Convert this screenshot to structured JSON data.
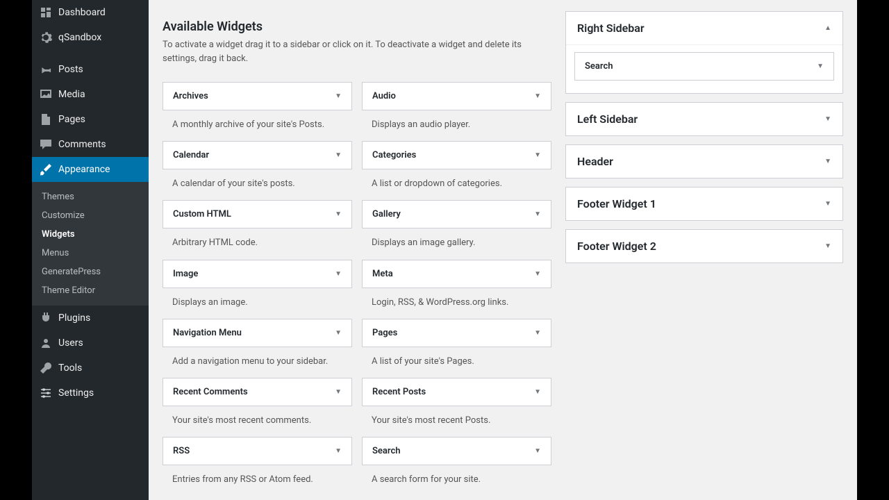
{
  "sidebar": {
    "items": [
      {
        "label": "Dashboard"
      },
      {
        "label": "qSandbox"
      },
      {
        "label": "Posts"
      },
      {
        "label": "Media"
      },
      {
        "label": "Pages"
      },
      {
        "label": "Comments"
      },
      {
        "label": "Appearance"
      },
      {
        "label": "Plugins"
      },
      {
        "label": "Users"
      },
      {
        "label": "Tools"
      },
      {
        "label": "Settings"
      }
    ],
    "submenu": [
      {
        "label": "Themes"
      },
      {
        "label": "Customize"
      },
      {
        "label": "Widgets"
      },
      {
        "label": "Menus"
      },
      {
        "label": "GeneratePress"
      },
      {
        "label": "Theme Editor"
      }
    ]
  },
  "main": {
    "heading": "Available Widgets",
    "description": "To activate a widget drag it to a sidebar or click on it. To deactivate a widget and delete its settings, drag it back.",
    "widgets": [
      {
        "title": "Archives",
        "desc": "A monthly archive of your site's Posts."
      },
      {
        "title": "Audio",
        "desc": "Displays an audio player."
      },
      {
        "title": "Calendar",
        "desc": "A calendar of your site's posts."
      },
      {
        "title": "Categories",
        "desc": "A list or dropdown of categories."
      },
      {
        "title": "Custom HTML",
        "desc": "Arbitrary HTML code."
      },
      {
        "title": "Gallery",
        "desc": "Displays an image gallery."
      },
      {
        "title": "Image",
        "desc": "Displays an image."
      },
      {
        "title": "Meta",
        "desc": "Login, RSS, & WordPress.org links."
      },
      {
        "title": "Navigation Menu",
        "desc": "Add a navigation menu to your sidebar."
      },
      {
        "title": "Pages",
        "desc": "A list of your site's Pages."
      },
      {
        "title": "Recent Comments",
        "desc": "Your site's most recent comments."
      },
      {
        "title": "Recent Posts",
        "desc": "Your site's most recent Posts."
      },
      {
        "title": "RSS",
        "desc": "Entries from any RSS or Atom feed."
      },
      {
        "title": "Search",
        "desc": "A search form for your site."
      }
    ]
  },
  "areas": {
    "right_sidebar": {
      "title": "Right Sidebar",
      "placed": "Search"
    },
    "left_sidebar": {
      "title": "Left Sidebar"
    },
    "header": {
      "title": "Header"
    },
    "footer1": {
      "title": "Footer Widget 1"
    },
    "footer2": {
      "title": "Footer Widget 2"
    }
  }
}
